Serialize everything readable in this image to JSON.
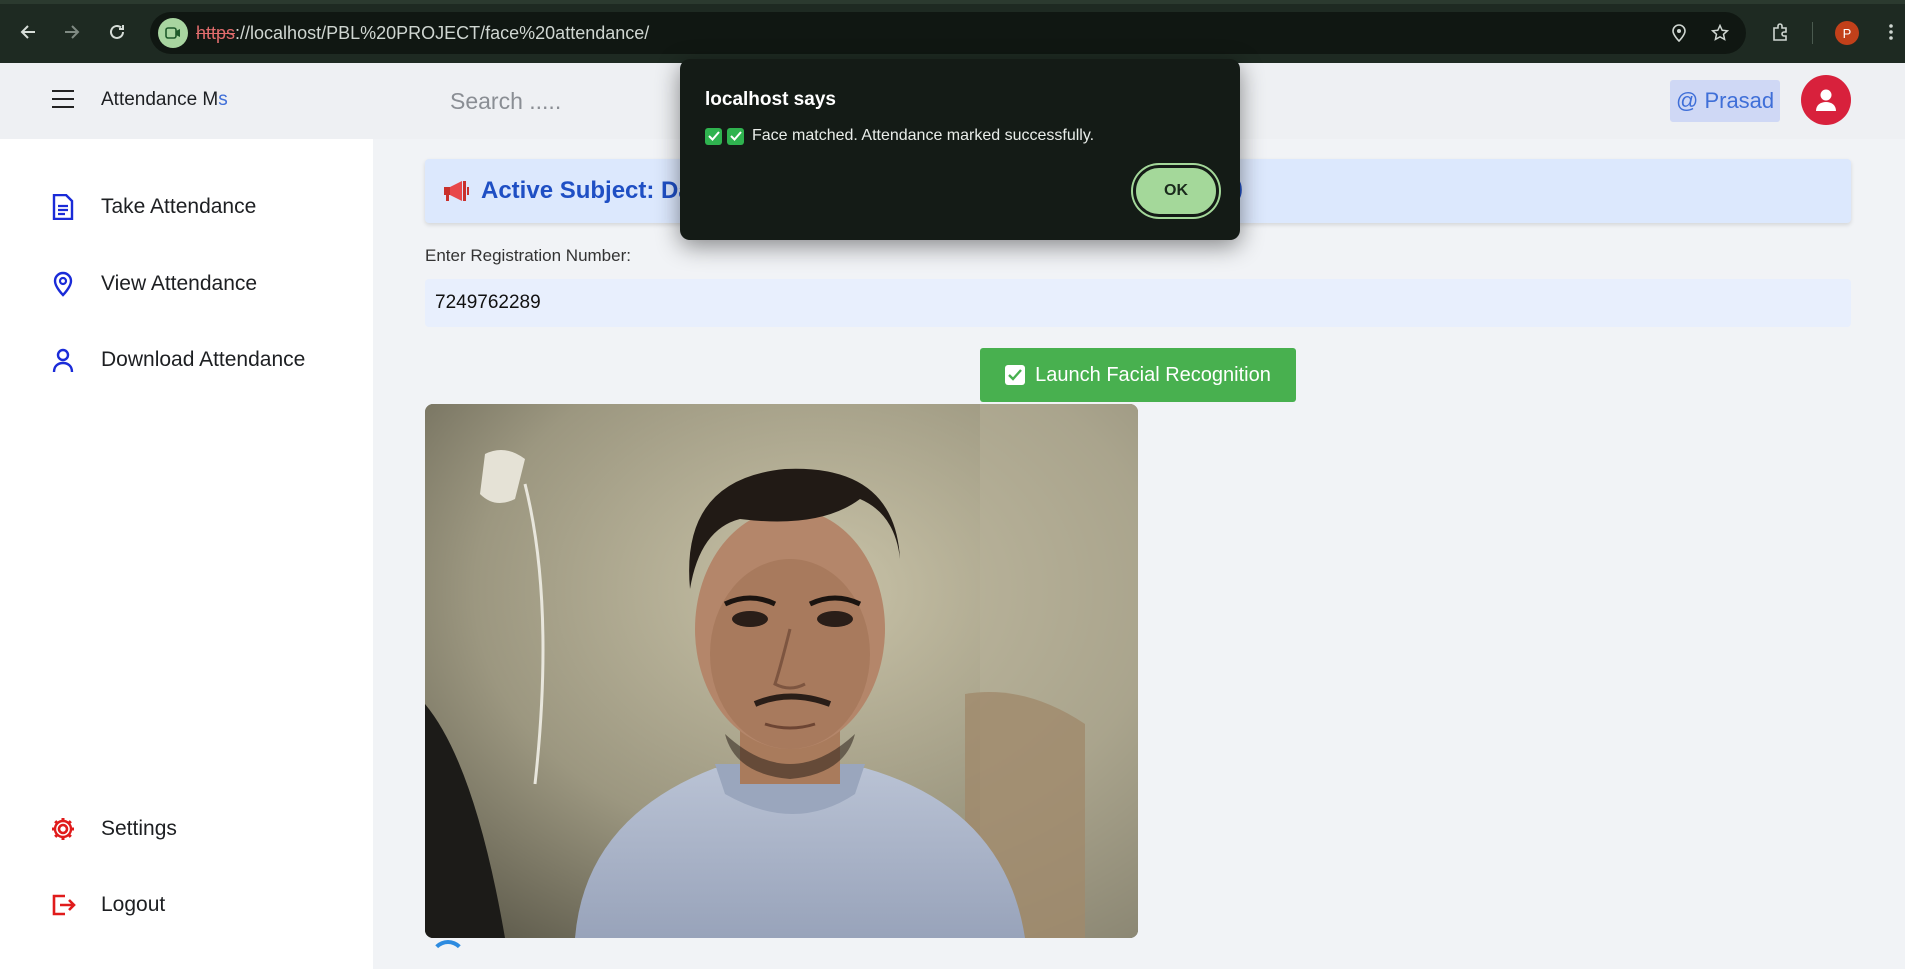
{
  "browser": {
    "url_scheme": "https",
    "url_rest": "://localhost/PBL%20PROJECT/face%20attendance/",
    "profile_initial": "P"
  },
  "header": {
    "brand_main": "Attendance M",
    "brand_accent": "s",
    "search_placeholder": "Search .....",
    "user_label": "@ Prasad"
  },
  "sidebar": {
    "items": [
      {
        "label": "Take Attendance",
        "icon": "document-icon",
        "color": "#1a2bd8"
      },
      {
        "label": "View Attendance",
        "icon": "location-pin-icon",
        "color": "#1a2bd8"
      },
      {
        "label": "Download Attendance",
        "icon": "user-icon",
        "color": "#1a2bd8"
      }
    ],
    "bottom": [
      {
        "label": "Settings",
        "icon": "gear-icon",
        "color": "#e01b1b"
      },
      {
        "label": "Logout",
        "icon": "logout-icon",
        "color": "#e01b1b"
      }
    ]
  },
  "main": {
    "banner_text": "Active Subject: Da",
    "banner_tail": ")",
    "reg_label": "Enter Registration Number:",
    "reg_value": "7249762289",
    "launch_label": "Launch Facial Recognition"
  },
  "dialog": {
    "title": "localhost says",
    "message": "Face matched. Attendance marked successfully.",
    "ok_label": "OK"
  },
  "colors": {
    "accent_blue": "#1f4fc4",
    "launch_green": "#48b04f",
    "avatar_red": "#d8213c"
  }
}
